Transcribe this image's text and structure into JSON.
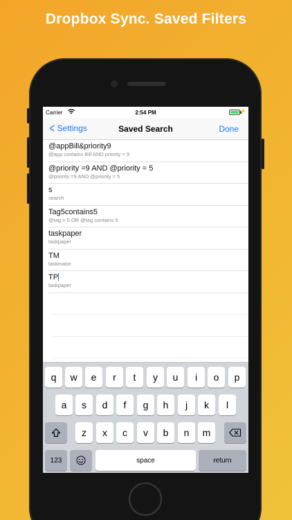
{
  "headline": "Dropbox Sync. Saved Filters",
  "status": {
    "carrier": "Carrier",
    "time": "2:54 PM"
  },
  "nav": {
    "back_label": "Settings",
    "title": "Saved Search",
    "done_label": "Done"
  },
  "rows": [
    {
      "title": "@appBill&priority9",
      "subtitle": "@app contains Bill AND priority = 9"
    },
    {
      "title": "@priority =9 AND @priority = 5",
      "subtitle": "@priority =9 AND @priority = 5"
    },
    {
      "title": "s",
      "subtitle": "search"
    },
    {
      "title": "Tag5contains5",
      "subtitle": "@tag = 5 OR @tag contains 5"
    },
    {
      "title": "taskpaper",
      "subtitle": "taskpaper"
    },
    {
      "title": "TM",
      "subtitle": "taskmator"
    },
    {
      "title": "TP",
      "subtitle": "taskpaper"
    }
  ],
  "keyboard": {
    "row1": [
      "q",
      "w",
      "e",
      "r",
      "t",
      "y",
      "u",
      "i",
      "o",
      "p"
    ],
    "row2": [
      "a",
      "s",
      "d",
      "f",
      "g",
      "h",
      "j",
      "k",
      "l"
    ],
    "row3": [
      "z",
      "x",
      "c",
      "v",
      "b",
      "n",
      "m"
    ],
    "numbers_label": "123",
    "space_label": "space",
    "return_label": "return"
  },
  "colors": {
    "accent": "#1a78f2",
    "background": "#f2b531",
    "battery": "#4cd964"
  }
}
